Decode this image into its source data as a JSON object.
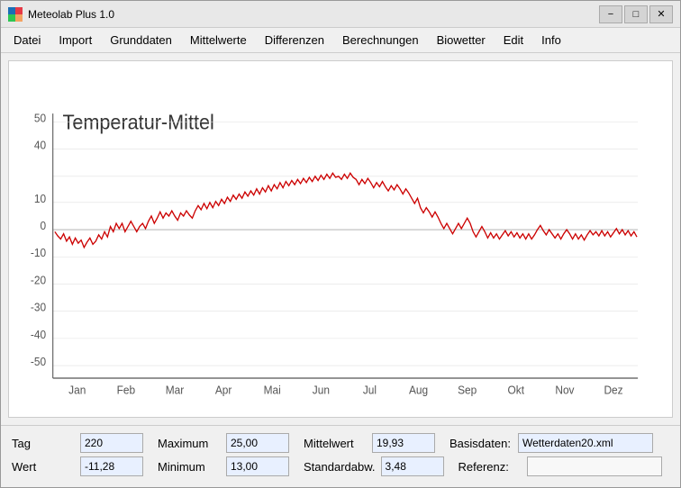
{
  "titlebar": {
    "title": "Meteolab Plus 1.0",
    "minimize_label": "−",
    "maximize_label": "□",
    "close_label": "✕"
  },
  "menubar": {
    "items": [
      {
        "label": "Datei"
      },
      {
        "label": "Import"
      },
      {
        "label": "Grunddaten"
      },
      {
        "label": "Mittelwerte"
      },
      {
        "label": "Differenzen"
      },
      {
        "label": "Berechnungen"
      },
      {
        "label": "Biowetter"
      },
      {
        "label": "Edit"
      },
      {
        "label": "Info"
      }
    ]
  },
  "chart": {
    "title": "Temperatur-Mittel",
    "y_labels": [
      "50",
      "40",
      "10",
      "0",
      "-10",
      "-20",
      "-30",
      "-40",
      "-50"
    ],
    "x_labels": [
      "Jan",
      "Feb",
      "Mar",
      "Apr",
      "Mai",
      "Jun",
      "Jul",
      "Aug",
      "Sep",
      "Okt",
      "Nov",
      "Dez"
    ]
  },
  "fields": {
    "tag_label": "Tag",
    "tag_value": "220",
    "wert_label": "Wert",
    "wert_value": "-11,28",
    "maximum_label": "Maximum",
    "maximum_value": "25,00",
    "minimum_label": "Minimum",
    "minimum_value": "13,00",
    "mittelwert_label": "Mittelwert",
    "mittelwert_value": "19,93",
    "standardabw_label": "Standardabw.",
    "standardabw_value": "3,48",
    "basisdaten_label": "Basisdaten:",
    "basisdaten_value": "Wetterdaten20.xml",
    "referenz_label": "Referenz:",
    "referenz_value": ""
  }
}
